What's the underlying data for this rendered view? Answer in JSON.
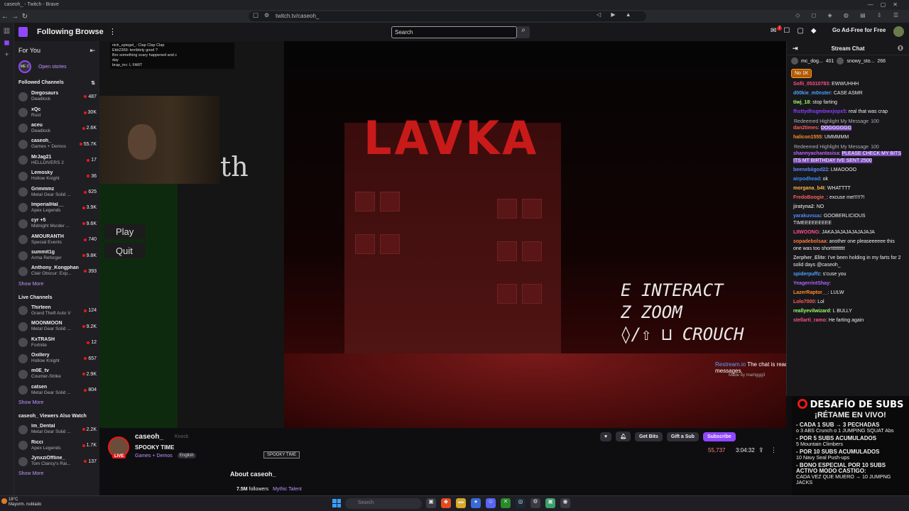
{
  "browser": {
    "window_title": "caseoh_ - Twitch - Brave",
    "url": "twitch.tv/caseoh_"
  },
  "nav": {
    "following": "Following",
    "browse": "Browse",
    "search_placeholder": "Search",
    "notif_count": "7",
    "ad_free": "Go Ad-Free for Free"
  },
  "sidebar": {
    "for_you": "For You",
    "open_stories": "Open stories",
    "story_avatar": "ME C",
    "followed_header": "Followed Channels",
    "followed": [
      {
        "name": "Diegosaurs",
        "game": "Deadlock",
        "viewers": "487"
      },
      {
        "name": "xQc",
        "game": "Rust",
        "viewers": "30K"
      },
      {
        "name": "aceu",
        "game": "Deadlock",
        "viewers": "2.6K"
      },
      {
        "name": "caseoh_",
        "game": "Games + Demos",
        "viewers": "55.7K"
      },
      {
        "name": "MrJag21",
        "game": "HELLDIVERS 2",
        "viewers": "17"
      },
      {
        "name": "Lemosky",
        "game": "Hollow Knight",
        "viewers": "36"
      },
      {
        "name": "Grimmmz",
        "game": "Metal Gear Solid ...",
        "viewers": "625"
      },
      {
        "name": "ImperialHal__",
        "game": "Apex Legends",
        "viewers": "3.9K"
      },
      {
        "name": "cyr +5",
        "game": "Midnight Murder ...",
        "viewers": "9.6K"
      },
      {
        "name": "AMOURANTH",
        "game": "Special Events",
        "viewers": "740"
      },
      {
        "name": "summit1g",
        "game": "Arma Reforger",
        "viewers": "9.8K"
      },
      {
        "name": "Anthony_Kongphan",
        "game": "Clair Obscur: Exp...",
        "viewers": "393"
      }
    ],
    "show_more_1": "Show More",
    "live_header": "Live Channels",
    "live": [
      {
        "name": "Thirteen",
        "game": "Grand Theft Auto V",
        "viewers": "124"
      },
      {
        "name": "MOONMOON",
        "game": "Metal Gear Solid ...",
        "viewers": "9.2K"
      },
      {
        "name": "KxTRASH",
        "game": "Fortnite",
        "viewers": "12"
      },
      {
        "name": "Oxillery",
        "game": "Hollow Knight",
        "viewers": "657"
      },
      {
        "name": "m0E_tv",
        "game": "Counter-Strike",
        "viewers": "2.9K"
      },
      {
        "name": "catsen",
        "game": "Metal Gear Solid ...",
        "viewers": "804"
      }
    ],
    "show_more_2": "Show More",
    "also_header": "caseoh_ Viewers Also Watch",
    "also": [
      {
        "name": "lm_Dental",
        "game": "Metal Gear Solid ...",
        "viewers": "2.2K"
      },
      {
        "name": "Ricci",
        "game": "Apex Legends",
        "viewers": "1.7K"
      },
      {
        "name": "JynxziOffline_",
        "game": "Tom Clancy's Rai...",
        "viewers": "137"
      }
    ],
    "show_more_3": "Show More"
  },
  "video": {
    "sign": "LAVKA",
    "th_text": "th",
    "menu_play": "Play",
    "menu_quit": "Quit",
    "overlay_chat": [
      "nick_spiegel_: Clap Clap Clap",
      "Ekb2369: terriblely good ?",
      "Bro something scary happened and c",
      "day",
      "brap_inc: L FART"
    ],
    "controls": [
      "E INTERACT",
      "Z ZOOM",
      "◊/⇧ ⊔ CROUCH"
    ],
    "restream": "Restream.io",
    "restream_msg": "The chat is ready to display messages.",
    "made_by": "Made by martiggg3"
  },
  "stream": {
    "name": "caseoh_",
    "knock": "Knock",
    "title": "SPOOKY TIME",
    "category": "Games + Demos",
    "language": "English",
    "tag": "SPOOKY TIME",
    "live": "LIVE",
    "get_bits": "Get Bits",
    "gift_sub": "Gift a Sub",
    "subscribe": "Subscribe",
    "viewers": "55,737",
    "uptime": "3:04:32",
    "about": "About caseoh_",
    "followers": "7.5M",
    "followers_label": "followers",
    "team": "Mythic Talent"
  },
  "chat": {
    "title": "Stream Chat",
    "pins": [
      {
        "name": "mc_dog...",
        "count": "401"
      },
      {
        "name": "snowy_sto...",
        "count": "266"
      }
    ],
    "hype": "No  1K",
    "messages": [
      {
        "user": "Sofii_05310783",
        "text": "EWWUHHH",
        "color": "#ff4f8b"
      },
      {
        "user": "d00kie_m0nster",
        "text": "CASE ASMR",
        "color": "#4fa0ff"
      },
      {
        "user": "tiwj_18",
        "text": "stop farting",
        "color": "#9dff6b"
      },
      {
        "user": "fhsttydhsgmbwxjopx5",
        "text": "real that was crap",
        "color": "#8b3dff"
      },
      {
        "redeem": "Redeemed Highlight My Message",
        "points": "100"
      },
      {
        "user": "dan2times",
        "text": "OOGGGGGG",
        "color": "#ff5c5c",
        "highlight": true
      },
      {
        "user": "halicon1555",
        "text": "UMMMMM",
        "color": "#ff8a2a"
      },
      {
        "redeem": "Redeemed Highlight My Message",
        "points": "100"
      },
      {
        "user": "shannyachantasisa",
        "text": "PLEASE CHECK MY BITS ITS MT BIRTHDAY IVE SENT 2500",
        "color": "#c060ff",
        "highlight": true
      },
      {
        "user": "beenebiigod22",
        "text": "LMAOOOO",
        "color": "#5c8bff"
      },
      {
        "user": "airpodhead",
        "text": "ok",
        "color": "#3d8bff"
      },
      {
        "user": "morgana_b4t",
        "text": "WHATTTT",
        "color": "#ffb340"
      },
      {
        "user": "FredoBoogie_",
        "text": "excuse me!!!!!?!",
        "color": "#ff5c5c"
      },
      {
        "user": "jiratyna2",
        "text": "NO",
        "color": "#c8c8c8"
      },
      {
        "user": "yarakuvsuu",
        "text": "GOOBERLICIOUS TIMEEEEEEEEE",
        "color": "#4f8bff"
      },
      {
        "user": "LIIWOONG",
        "text": "JAKAJAJAJAJAJAJAJA",
        "color": "#ff4f8b"
      },
      {
        "user": "sopadebolsaa",
        "text": "another one pleaseeeeee this one was too shortttttttttt",
        "color": "#ff7a3d"
      },
      {
        "user": "Zerpher_Elite",
        "text": "I've been holding in my farts for 2 solid days @caseoh_",
        "color": "#c8c8c8"
      },
      {
        "user": "spiderpuffz",
        "text": "s'cuse you",
        "color": "#4fa0ff"
      },
      {
        "user": "YeagerrintShay",
        "text": "",
        "color": "#b060ff"
      },
      {
        "user": "LazerRaptor__",
        "text": "LULW",
        "color": "#ff8a2a"
      },
      {
        "user": "Lolo7000",
        "text": "Lol",
        "color": "#ff5c5c"
      },
      {
        "user": "reallyevilwizard",
        "text": "L BULLY",
        "color": "#9dff6b"
      },
      {
        "user": "stellarti_ramo",
        "text": "He farting again",
        "color": "#ff4f8b"
      }
    ]
  },
  "subs_panel": {
    "title": "DESAFÍO DE SUBS",
    "subtitle": "¡RÉTAME EN VIVO!",
    "rules": [
      {
        "head": "- CADA 1 SUB → 3 PECHADAS",
        "sub": "o 3 ABS Crunch o 1 JUMPING SQUAT Abs"
      },
      {
        "head": "- POR 5 SUBS ACUMULADOS",
        "sub": "5 Mountain Climbers"
      },
      {
        "head": "- POR 10 SUBS ACUMULADOS",
        "sub": "10 Navy Seal Push-ups"
      },
      {
        "head": "- BONO ESPECIAL POR 10 SUBS ACTIVO MODO CASTIGO:",
        "sub": "CADA VEZ QUE MUERO → 10 JUMPNG JACKS"
      }
    ]
  },
  "taskbar": {
    "temp": "18°C",
    "weather": "Mayorm. nublado",
    "search": "Search"
  }
}
